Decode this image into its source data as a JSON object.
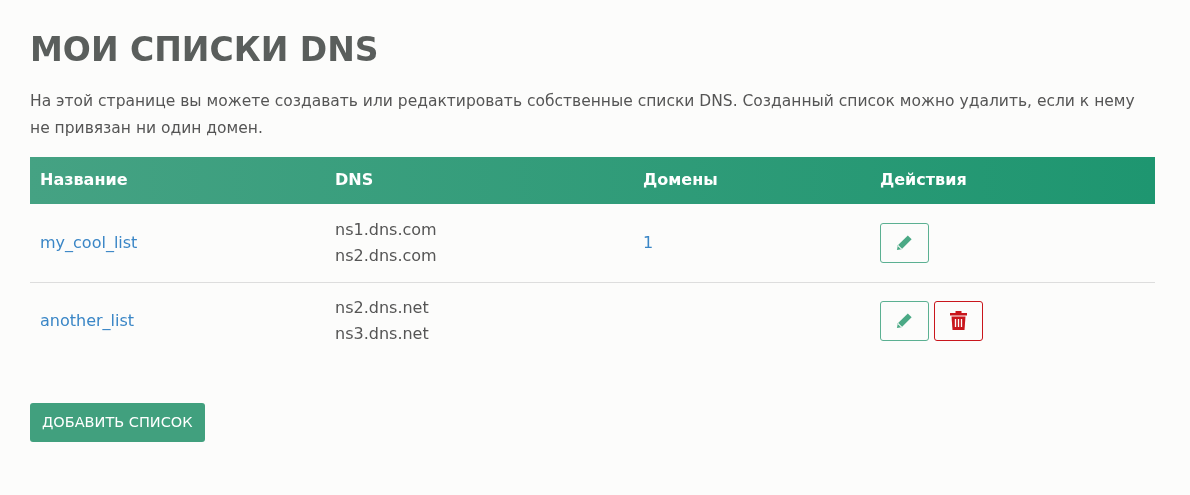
{
  "title": "МОИ СПИСКИ DNS",
  "description": "На этой странице вы можете создавать или редактировать собственные списки DNS. Созданный список можно удалить, если к нему не привязан ни один домен.",
  "table": {
    "columns": [
      "Название",
      "DNS",
      "Домены",
      "Действия"
    ],
    "rows": [
      {
        "name": "my_cool_list",
        "dns": [
          "ns1.dns.com",
          "ns2.dns.com"
        ],
        "domains": "1",
        "actions": [
          {
            "kind": "edit"
          }
        ]
      },
      {
        "name": "another_list",
        "dns": [
          "ns2.dns.net",
          "ns3.dns.net"
        ],
        "actions": [
          {
            "kind": "edit"
          },
          {
            "kind": "delete"
          }
        ]
      }
    ]
  },
  "add_button": "ДОБАВИТЬ СПИСОК"
}
